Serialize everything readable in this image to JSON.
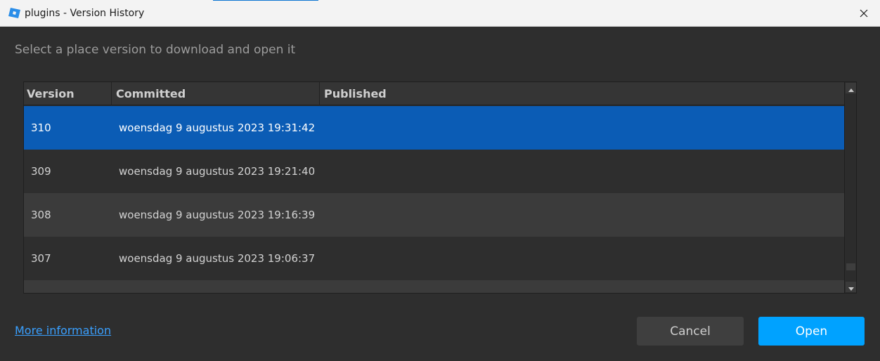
{
  "window": {
    "title": "plugins - Version History",
    "app_icon": "roblox-studio-icon",
    "close_icon": "close-icon"
  },
  "instruction": "Select a place version to download and open it",
  "table": {
    "columns": [
      "Version",
      "Committed",
      "Published"
    ],
    "rows": [
      {
        "version": "310",
        "committed": "woensdag 9 augustus 2023 19:31:42",
        "published": "",
        "selected": true
      },
      {
        "version": "309",
        "committed": "woensdag 9 augustus 2023 19:21:40",
        "published": ""
      },
      {
        "version": "308",
        "committed": "woensdag 9 augustus 2023 19:16:39",
        "published": ""
      },
      {
        "version": "307",
        "committed": "woensdag 9 augustus 2023 19:06:37",
        "published": ""
      }
    ]
  },
  "footer": {
    "more_info": "More information",
    "cancel": "Cancel",
    "open": "Open"
  },
  "colors": {
    "selected_row": "#0b5cb5",
    "primary_button": "#00a2ff",
    "link": "#3aa0ff"
  }
}
